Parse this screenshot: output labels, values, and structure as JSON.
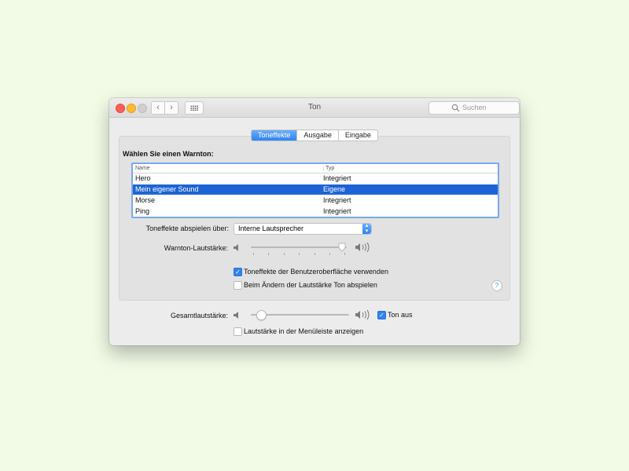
{
  "window": {
    "title": "Ton"
  },
  "toolbar": {
    "back_icon": "chevron-left-icon",
    "forward_icon": "chevron-right-icon",
    "grid_icon": "grid-icon"
  },
  "search": {
    "placeholder": "Suchen"
  },
  "tabs": [
    {
      "label": "Toneffekte",
      "active": true
    },
    {
      "label": "Ausgabe",
      "active": false
    },
    {
      "label": "Eingabe",
      "active": false
    }
  ],
  "alert": {
    "heading": "Wählen Sie einen Warnton:",
    "columns": [
      "Name",
      "Typ"
    ],
    "rows": [
      {
        "name": "Hero",
        "type": "Integriert",
        "selected": false
      },
      {
        "name": "Mein eigener Sound",
        "type": "Eigene",
        "selected": true
      },
      {
        "name": "Morse",
        "type": "Integriert",
        "selected": false
      },
      {
        "name": "Ping",
        "type": "Integriert",
        "selected": false
      }
    ]
  },
  "playback": {
    "label": "Toneffekte abspielen über:",
    "value": "Interne Lautsprecher"
  },
  "alert_volume": {
    "label": "Warnton-Lautstärke:",
    "level": 0.95
  },
  "checkboxes": {
    "ui_effects": {
      "label": "Toneffekte der Benutzeroberfläche verwenden",
      "checked": true
    },
    "volume_feedback": {
      "label": "Beim Ändern der Lautstärke Ton abspielen",
      "checked": false
    }
  },
  "help": {
    "label": "?"
  },
  "output_volume": {
    "label": "Gesamtlautstärke:",
    "level": 0.1
  },
  "mute": {
    "label": "Ton aus",
    "checked": true
  },
  "menubar": {
    "label": "Lautstärke in der Menüleiste anzeigen",
    "checked": false
  },
  "colors": {
    "accent": "#2f83f4",
    "selection": "#1c64d5",
    "background": "#f1fbe6"
  }
}
